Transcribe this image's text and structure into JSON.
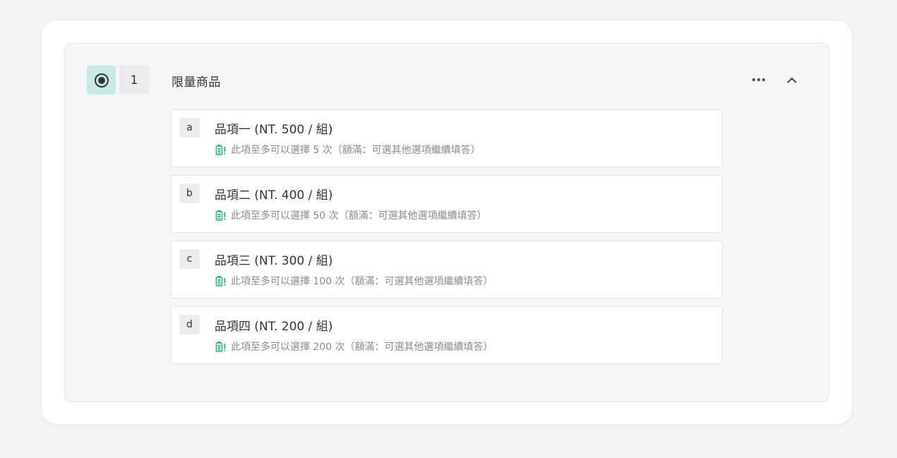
{
  "question": {
    "number": "1",
    "title": "限量商品",
    "type_icon": "radio-icon",
    "actions": {
      "more_icon": "more-horizontal-icon",
      "collapse_icon": "chevron-up-icon"
    }
  },
  "options": [
    {
      "key": "a",
      "label": "品項一 (NT. 500 / 組)",
      "limit_text": "此項至多可以選擇 5 次（額滿：可選其他選項繼續填答）"
    },
    {
      "key": "b",
      "label": "品項二 (NT. 400 / 組)",
      "limit_text": "此項至多可以選擇 50 次（額滿：可選其他選項繼續填答）"
    },
    {
      "key": "c",
      "label": "品項三 (NT. 300 / 組)",
      "limit_text": "此項至多可以選擇 100 次（額滿：可選其他選項繼續填答）"
    },
    {
      "key": "d",
      "label": "品項四 (NT. 200 / 組)",
      "limit_text": "此項至多可以選擇 200 次（額滿：可選其他選項繼續填答）"
    }
  ],
  "colors": {
    "type_badge_bg": "#c7ebe3",
    "battery_icon": "#2fb38f"
  },
  "limit_icon": "battery-alert-icon"
}
